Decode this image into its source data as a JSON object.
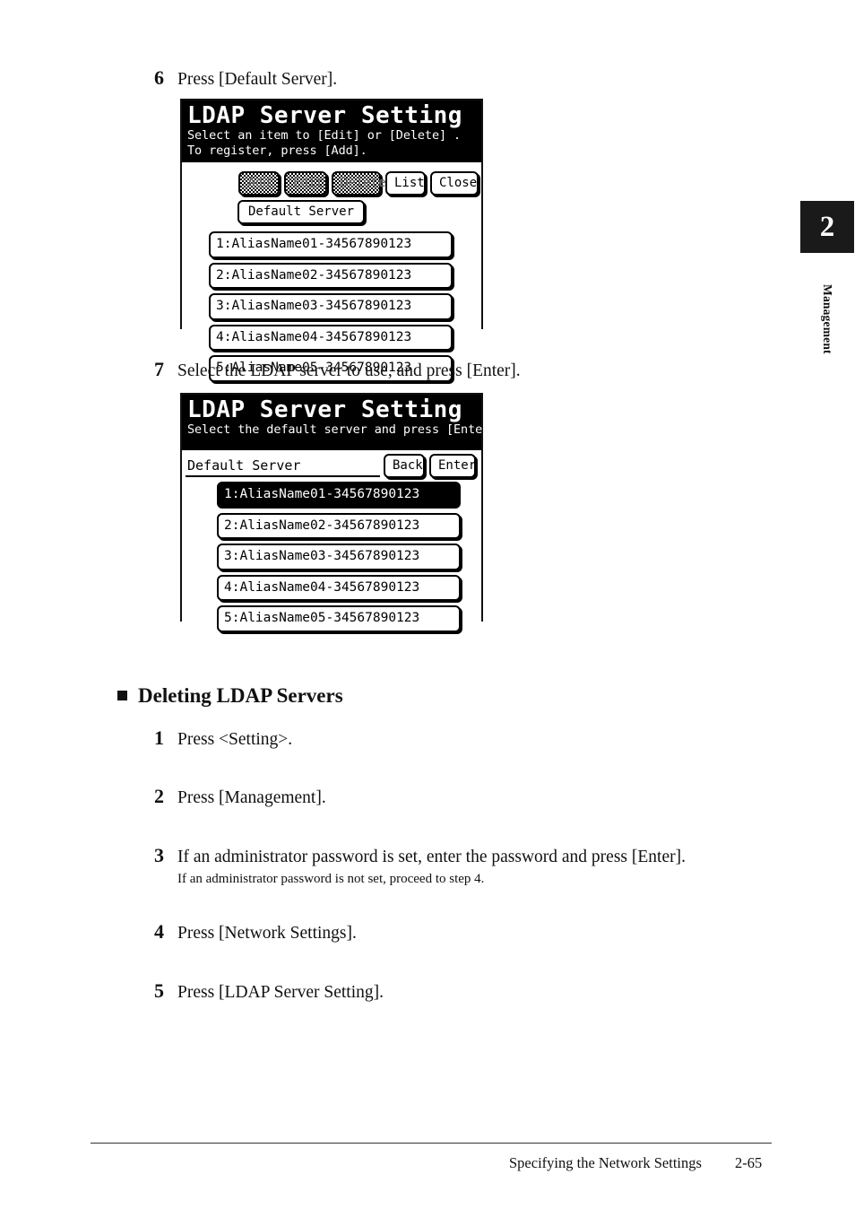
{
  "chapter_tab": {
    "number": "2",
    "label": "Management"
  },
  "steps_top": [
    {
      "number": "6",
      "text": "Press [Default Server]."
    },
    {
      "number": "7",
      "text": "Select the LDAP server to use, and press [Enter]."
    }
  ],
  "panel1": {
    "title": "LDAP Server Setting",
    "subtitle_line1": "Select an item to [Edit] or [Delete] .",
    "subtitle_line2": "To register, press  [Add].",
    "buttons": [
      {
        "label": "Add",
        "state": "disabled"
      },
      {
        "label": "Edit",
        "state": "disabled"
      },
      {
        "label": "Delete",
        "state": "disabled"
      },
      {
        "label": "List",
        "state": "enabled"
      },
      {
        "label": "Close",
        "state": "enabled"
      }
    ],
    "default_server_button": "Default Server",
    "items": [
      "1:AliasName01-34567890123",
      "2:AliasName02-34567890123",
      "3:AliasName03-34567890123",
      "4:AliasName04-34567890123",
      "5:AliasName05-34567890123"
    ]
  },
  "panel2": {
    "title": "LDAP Server Setting",
    "subtitle_line1": "Select the default server and press [Enter].",
    "field_label": "Default Server",
    "buttons": [
      {
        "label": "Back",
        "state": "enabled"
      },
      {
        "label": "Enter",
        "state": "enabled"
      }
    ],
    "items": [
      {
        "label": "1:AliasName01-34567890123",
        "selected": true
      },
      {
        "label": "2:AliasName02-34567890123",
        "selected": false
      },
      {
        "label": "3:AliasName03-34567890123",
        "selected": false
      },
      {
        "label": "4:AliasName04-34567890123",
        "selected": false
      },
      {
        "label": "5:AliasName05-34567890123",
        "selected": false
      }
    ]
  },
  "section": {
    "heading": "Deleting LDAP Servers"
  },
  "steps_bottom": [
    {
      "number": "1",
      "text": "Press <Setting>.",
      "note": null
    },
    {
      "number": "2",
      "text": "Press [Management].",
      "note": null
    },
    {
      "number": "3",
      "text": "If an administrator password is set, enter the password and press [Enter].",
      "note": "If an administrator password is not set, proceed to step 4."
    },
    {
      "number": "4",
      "text": "Press [Network Settings].",
      "note": null
    },
    {
      "number": "5",
      "text": "Press [LDAP Server Setting].",
      "note": null
    }
  ],
  "footer": {
    "text": "Specifying the Network Settings",
    "page": "2-65"
  }
}
